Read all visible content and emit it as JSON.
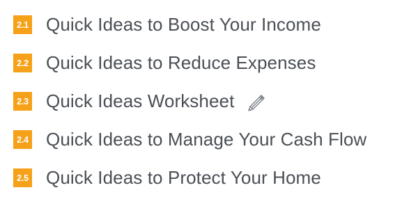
{
  "accent_color": "#f6a11a",
  "text_color": "#4a4f55",
  "toc": {
    "items": [
      {
        "number": "2.1",
        "label": "Quick Ideas to Boost Your Income"
      },
      {
        "number": "2.2",
        "label": "Quick Ideas to Reduce Expenses"
      },
      {
        "number": "2.3",
        "label": "Quick Ideas Worksheet",
        "icon": "pencil-icon"
      },
      {
        "number": "2.4",
        "label": "Quick Ideas to Manage Your Cash Flow"
      },
      {
        "number": "2.5",
        "label": "Quick Ideas to Protect Your Home"
      }
    ]
  }
}
